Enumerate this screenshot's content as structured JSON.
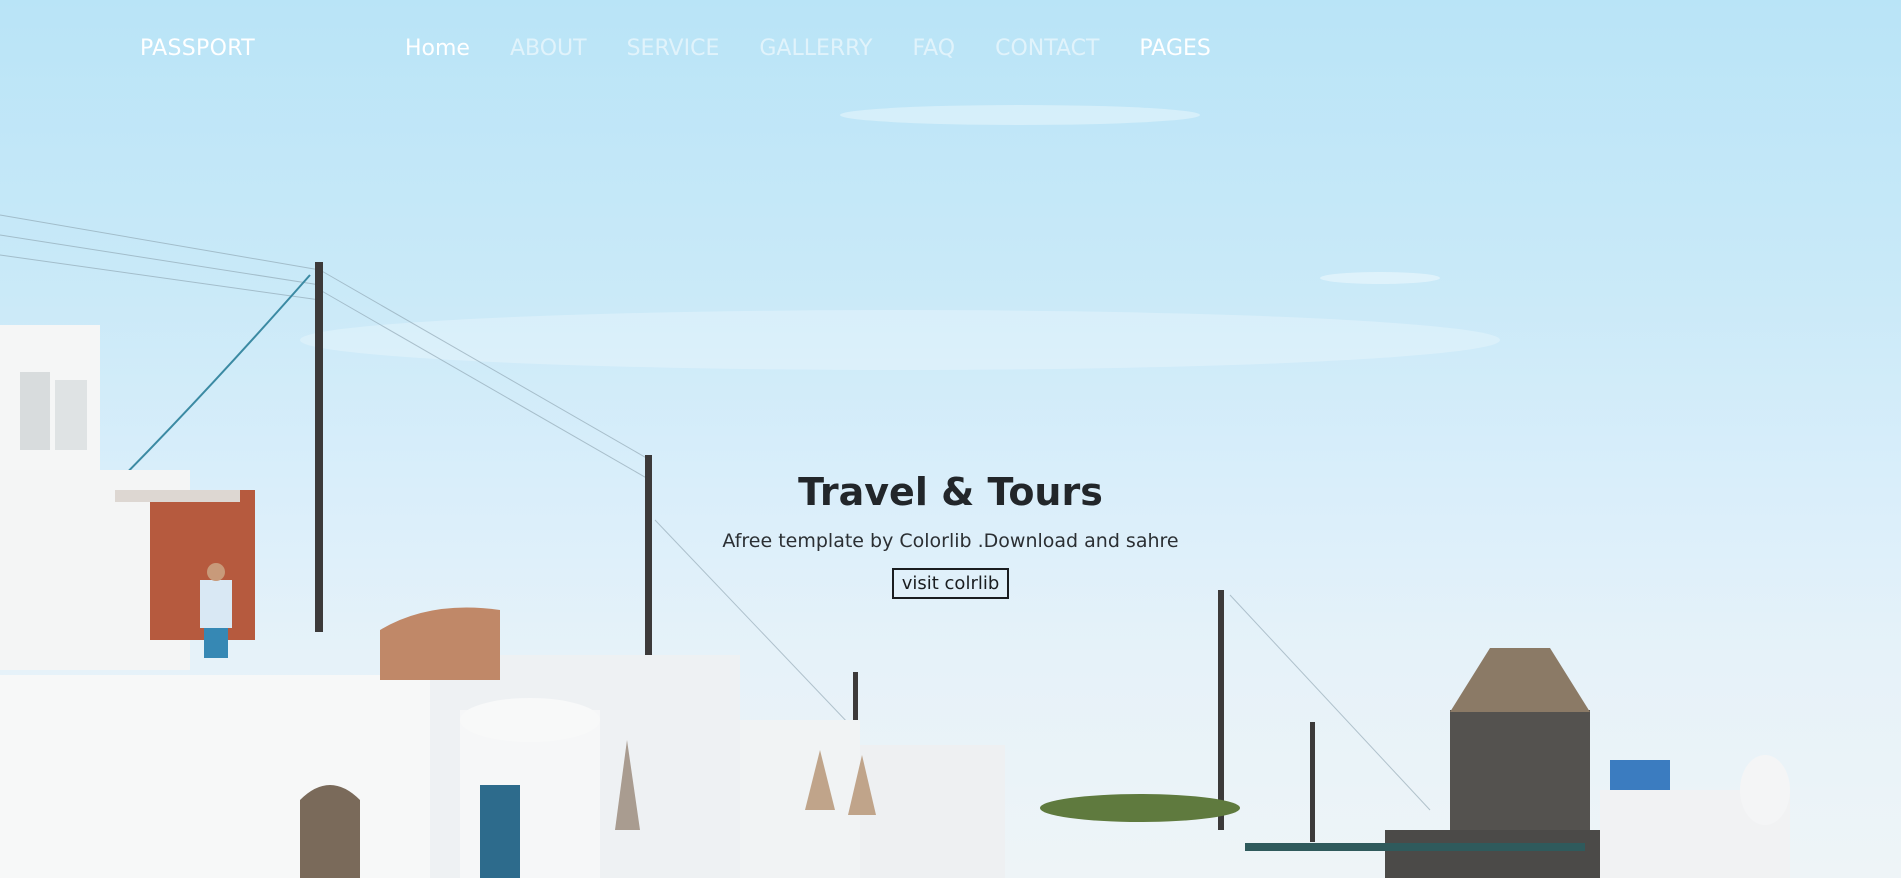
{
  "nav": {
    "brand": "PASSPORT",
    "items": [
      {
        "label": "Home",
        "state": "active"
      },
      {
        "label": "ABOUT",
        "state": "normal"
      },
      {
        "label": "SERVICE",
        "state": "normal"
      },
      {
        "label": "GALLERRY",
        "state": "normal"
      },
      {
        "label": "FAQ",
        "state": "normal"
      },
      {
        "label": "CONTACT",
        "state": "normal"
      },
      {
        "label": "PAGES",
        "state": "normal"
      }
    ]
  },
  "hero": {
    "title": "Travel & Tours",
    "subtitle": "Afree template by Colorlib .Download and sahre",
    "cta_label": "visit colrlib"
  },
  "colors": {
    "sky_top": "#b9e4f7",
    "sky_bottom": "#eef4f7",
    "text_dark": "#22262a",
    "nav_text": "#ffffff"
  }
}
